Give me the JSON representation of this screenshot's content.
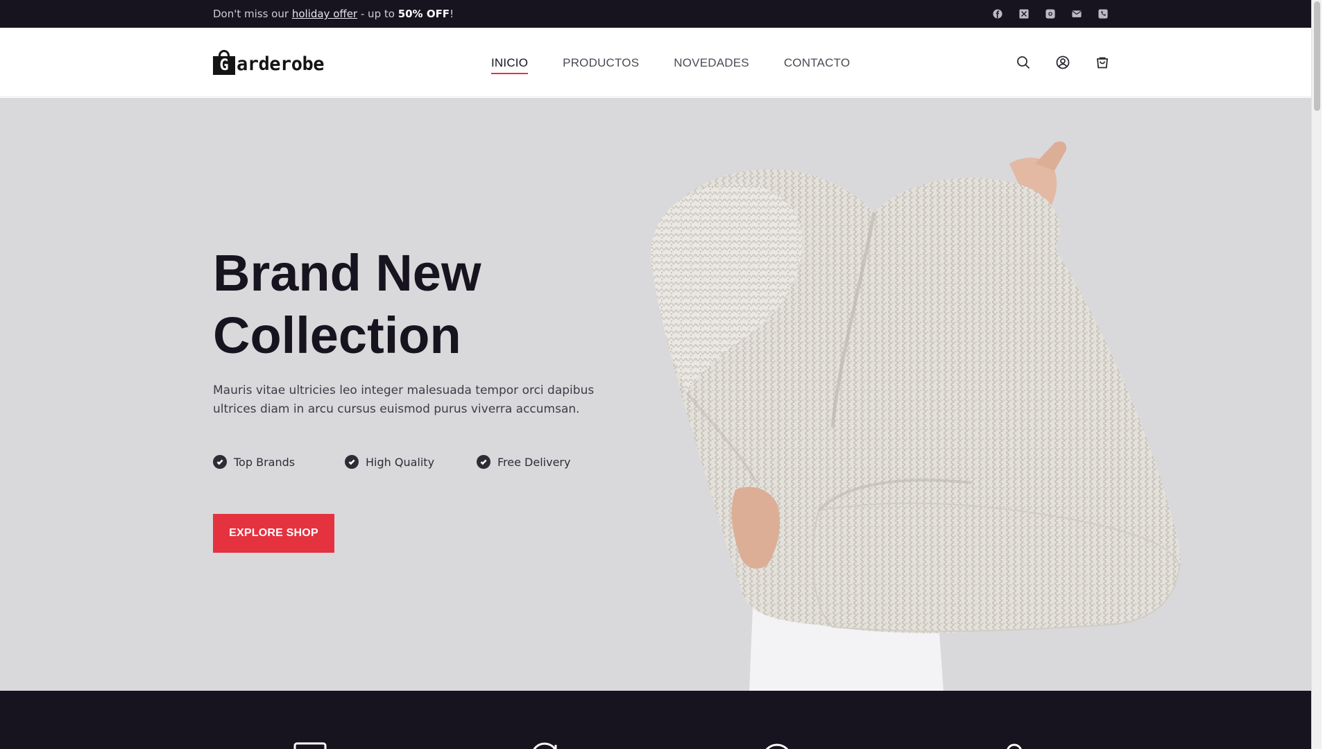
{
  "topbar": {
    "promo_prefix": "Don't miss our ",
    "promo_link": "holiday offer",
    "promo_middle": " - up to ",
    "promo_bold": "50% OFF",
    "promo_suffix": "!",
    "socials": [
      "facebook-icon",
      "x-icon",
      "instagram-icon",
      "mail-icon",
      "phone-icon"
    ]
  },
  "header": {
    "logo_letter": "G",
    "logo_text": "arderobe",
    "nav": [
      {
        "label": "INICIO",
        "active": true
      },
      {
        "label": "PRODUCTOS",
        "active": false
      },
      {
        "label": "NOVEDADES",
        "active": false
      },
      {
        "label": "CONTACTO",
        "active": false
      }
    ],
    "icons": [
      "search-icon",
      "account-icon",
      "cart-icon"
    ]
  },
  "hero": {
    "title_line1": "Brand New",
    "title_line2": "Collection",
    "description": "Mauris vitae ultricies leo integer malesuada tempor orci dapibus ultrices diam in arcu cursus euismod purus viverra accumsan.",
    "features": [
      "Top Brands",
      "High Quality",
      "Free Delivery"
    ],
    "cta_label": "EXPLORE SHOP"
  },
  "colors": {
    "accent": "#e4333f",
    "dark": "#17141f",
    "hero_bg": "#d9d9dc"
  }
}
